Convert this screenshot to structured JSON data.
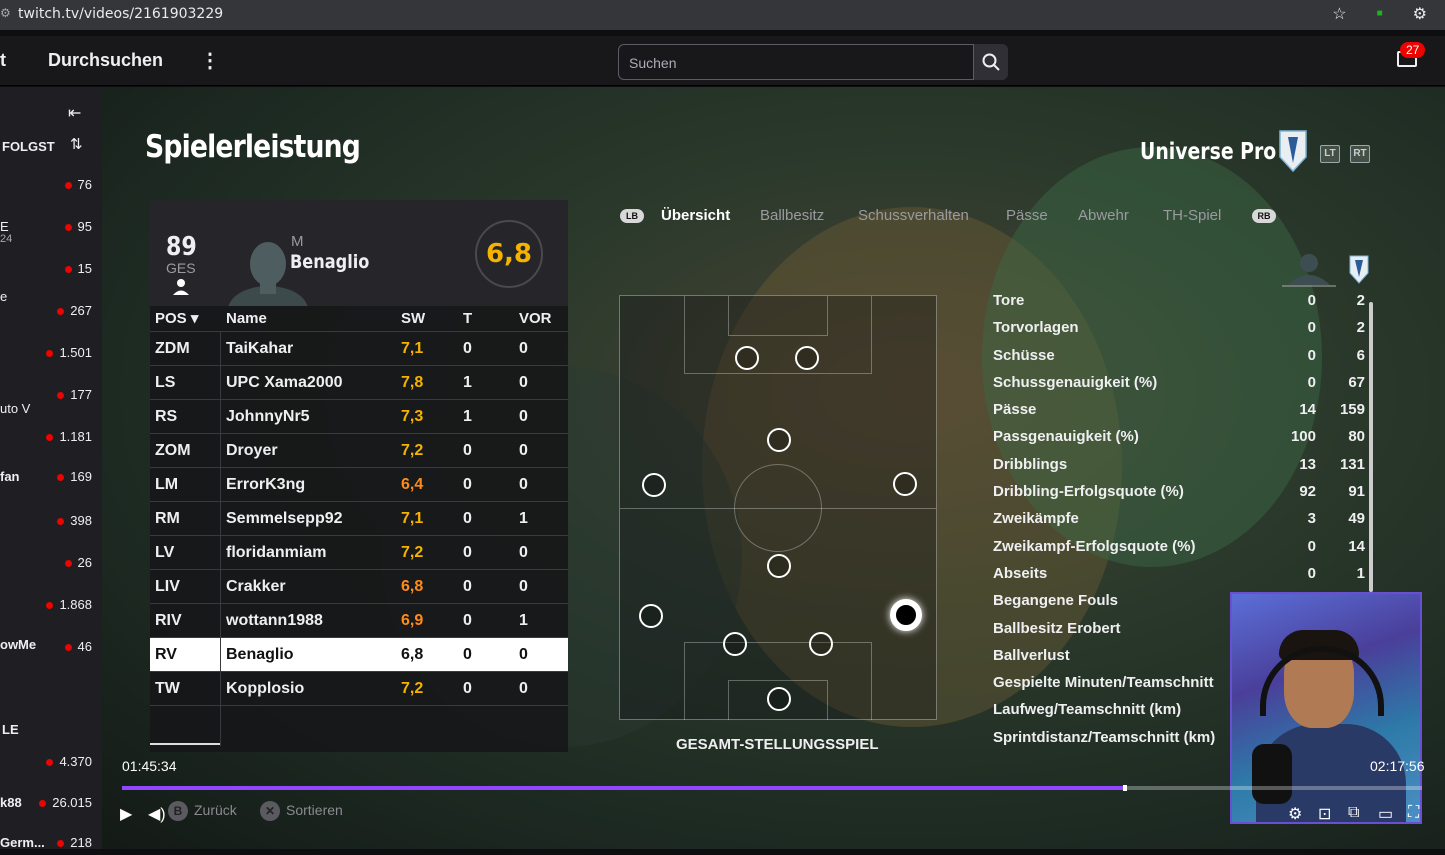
{
  "browser": {
    "url": "twitch.tv/videos/2161903229"
  },
  "topbar": {
    "cut_text": "t",
    "browse": "Durchsuchen",
    "search_placeholder": "Suchen",
    "notifications": "27"
  },
  "sidebar": {
    "header": "FOLGST",
    "rows": [
      {
        "name": "",
        "viewers": "76"
      },
      {
        "name": "E",
        "sub": "24",
        "viewers": "95"
      },
      {
        "name": "",
        "viewers": "15"
      },
      {
        "name": "e",
        "viewers": "267"
      },
      {
        "name": "",
        "viewers": "1.501"
      },
      {
        "name": "",
        "viewers": "177"
      },
      {
        "name": "uto V",
        "viewers": ""
      },
      {
        "name": "",
        "viewers": "1.181"
      },
      {
        "name": "fan",
        "viewers": "169"
      },
      {
        "name": "",
        "viewers": "398"
      },
      {
        "name": "",
        "viewers": "26"
      },
      {
        "name": "",
        "viewers": "1.868"
      },
      {
        "name": "owMe",
        "viewers": "46"
      }
    ],
    "section2": "LE",
    "rows2": [
      {
        "name": "",
        "viewers": "4.370"
      },
      {
        "name": "k88",
        "viewers": "26.015"
      },
      {
        "name": "Germ...",
        "viewers": "218"
      }
    ]
  },
  "game": {
    "title": "Spielerleistung",
    "team_name": "Universe Pro",
    "lt": "LT",
    "rt": "RT",
    "card": {
      "overall": "89",
      "ges": "GES",
      "position": "M",
      "player_name": "Benaglio",
      "rating": "6,8"
    },
    "table": {
      "headers": {
        "pos": "POS",
        "name": "Name",
        "sw": "SW",
        "t": "T",
        "vor": "VOR"
      },
      "rows": [
        {
          "pos": "ZDM",
          "name": "TaiKahar",
          "sw": "7,1",
          "t": "0",
          "vor": "0"
        },
        {
          "pos": "LS",
          "name": "UPC Xama2000",
          "sw": "7,8",
          "t": "1",
          "vor": "0"
        },
        {
          "pos": "RS",
          "name": "JohnnyNr5",
          "sw": "7,3",
          "t": "1",
          "vor": "0"
        },
        {
          "pos": "ZOM",
          "name": "Droyer",
          "sw": "7,2",
          "t": "0",
          "vor": "0"
        },
        {
          "pos": "LM",
          "name": "ErrorK3ng",
          "sw": "6,4",
          "t": "0",
          "vor": "0"
        },
        {
          "pos": "RM",
          "name": "Semmelsepp92",
          "sw": "7,1",
          "t": "0",
          "vor": "1"
        },
        {
          "pos": "LV",
          "name": "floridanmiam",
          "sw": "7,2",
          "t": "0",
          "vor": "0"
        },
        {
          "pos": "LIV",
          "name": "Crakker",
          "sw": "6,8",
          "t": "0",
          "vor": "0"
        },
        {
          "pos": "RIV",
          "name": "wottann1988",
          "sw": "6,9",
          "t": "0",
          "vor": "1"
        },
        {
          "pos": "RV",
          "name": "Benaglio",
          "sw": "6,8",
          "t": "0",
          "vor": "0"
        },
        {
          "pos": "TW",
          "name": "Kopplosio",
          "sw": "7,2",
          "t": "0",
          "vor": "0"
        }
      ]
    },
    "tabs": {
      "lb": "LB",
      "rb": "RB",
      "items": [
        "Übersicht",
        "Ballbesitz",
        "Schussverhalten",
        "Pässe",
        "Abwehr",
        "TH-Spiel"
      ]
    },
    "pitch_caption": "GESAMT-STELLUNGSSPIEL",
    "stats": [
      {
        "label": "Tore",
        "a": "0",
        "b": "2"
      },
      {
        "label": "Torvorlagen",
        "a": "0",
        "b": "2"
      },
      {
        "label": "Schüsse",
        "a": "0",
        "b": "6"
      },
      {
        "label": "Schussgenauigkeit (%)",
        "a": "0",
        "b": "67"
      },
      {
        "label": "Pässe",
        "a": "14",
        "b": "159"
      },
      {
        "label": "Passgenauigkeit (%)",
        "a": "100",
        "b": "80"
      },
      {
        "label": "Dribblings",
        "a": "13",
        "b": "131"
      },
      {
        "label": "Dribbling-Erfolgsquote (%)",
        "a": "92",
        "b": "91"
      },
      {
        "label": "Zweikämpfe",
        "a": "3",
        "b": "49"
      },
      {
        "label": "Zweikampf-Erfolgsquote (%)",
        "a": "0",
        "b": "14"
      },
      {
        "label": "Abseits",
        "a": "0",
        "b": "1"
      },
      {
        "label": "Begangene Fouls",
        "a": "",
        "b": ""
      },
      {
        "label": "Ballbesitz Erobert",
        "a": "",
        "b": ""
      },
      {
        "label": "Ballverlust",
        "a": "",
        "b": ""
      },
      {
        "label": "Gespielte Minuten/Teamschnitt",
        "a": "",
        "b": ""
      },
      {
        "label": "Laufweg/Teamschnitt (km)",
        "a": "",
        "b": ""
      },
      {
        "label": "Sprintdistanz/Teamschnitt (km)",
        "a": "",
        "b": ""
      }
    ],
    "hints": {
      "back": "Zurück",
      "sort": "Sortieren"
    }
  },
  "video": {
    "elapsed": "01:45:34",
    "duration": "02:17:56",
    "progress": 0.77
  },
  "colors": {
    "accent": "#9147ff",
    "rating": "#f5b300",
    "live": "#eb0400"
  }
}
